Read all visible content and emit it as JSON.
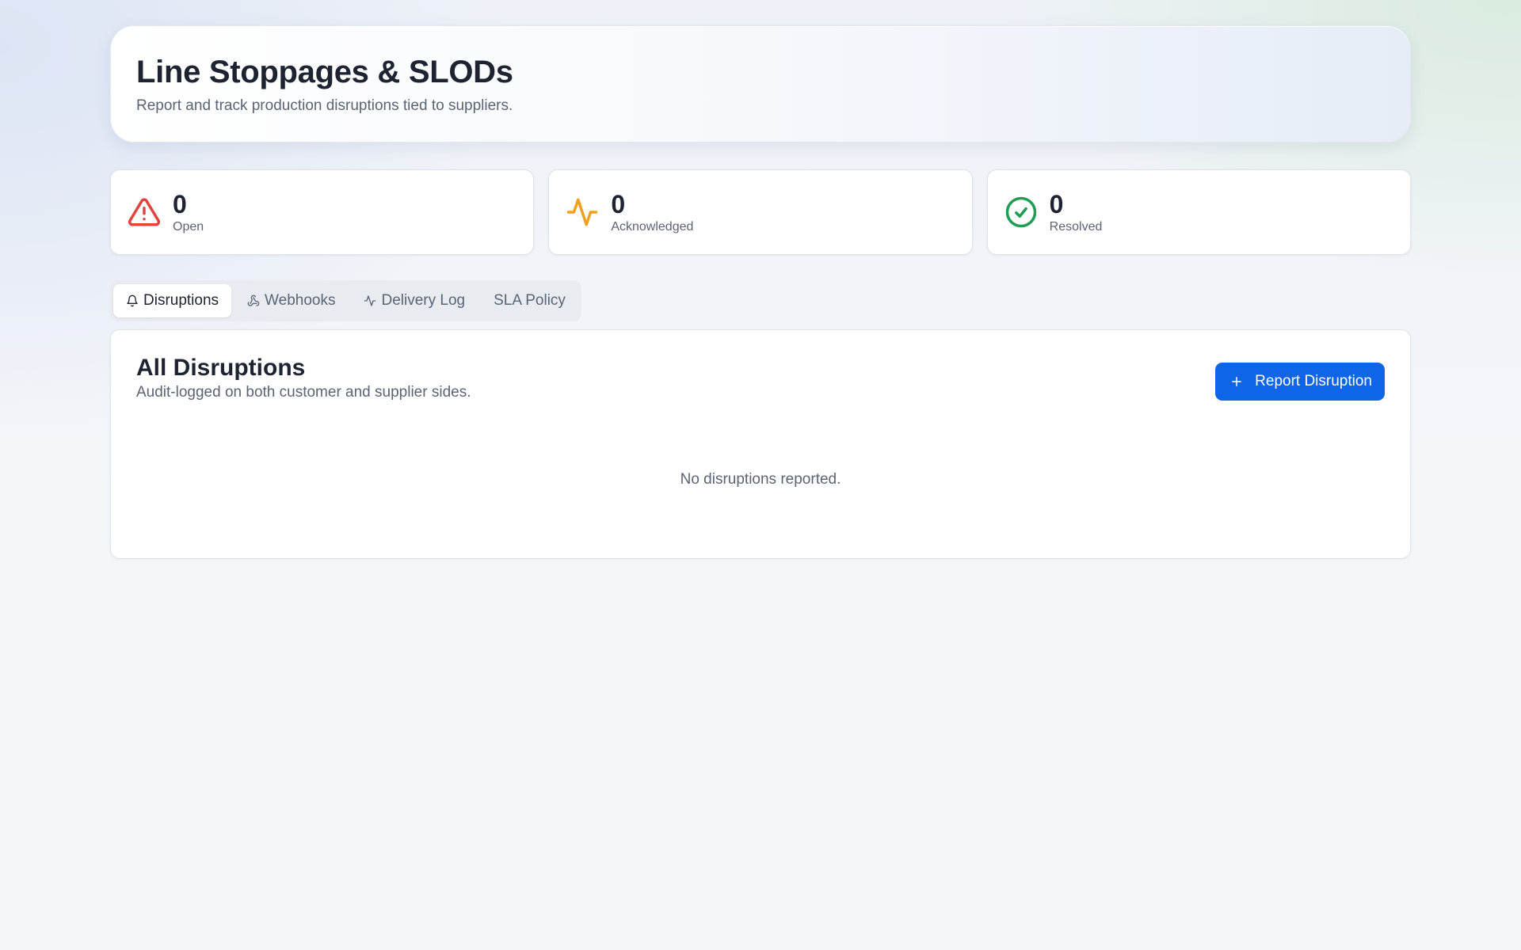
{
  "header": {
    "title": "Line Stoppages & SLODs",
    "subtitle": "Report and track production disruptions tied to suppliers."
  },
  "stats": [
    {
      "value": "0",
      "label": "Open",
      "icon": "alert-triangle-icon",
      "color": "#e0443e"
    },
    {
      "value": "0",
      "label": "Acknowledged",
      "icon": "activity-icon",
      "color": "#f0a01c"
    },
    {
      "value": "0",
      "label": "Resolved",
      "icon": "check-circle-icon",
      "color": "#1f9d55"
    }
  ],
  "tabs": [
    {
      "label": "Disruptions",
      "icon": "bell-icon",
      "active": true
    },
    {
      "label": "Webhooks",
      "icon": "webhook-icon",
      "active": false
    },
    {
      "label": "Delivery Log",
      "icon": "activity-icon",
      "active": false
    },
    {
      "label": "SLA Policy",
      "icon": "",
      "active": false
    }
  ],
  "panel": {
    "title": "All Disruptions",
    "subtitle": "Audit-logged on both customer and supplier sides.",
    "action_label": "Report Disruption",
    "empty_text": "No disruptions reported."
  },
  "colors": {
    "accent": "#1064e8"
  }
}
